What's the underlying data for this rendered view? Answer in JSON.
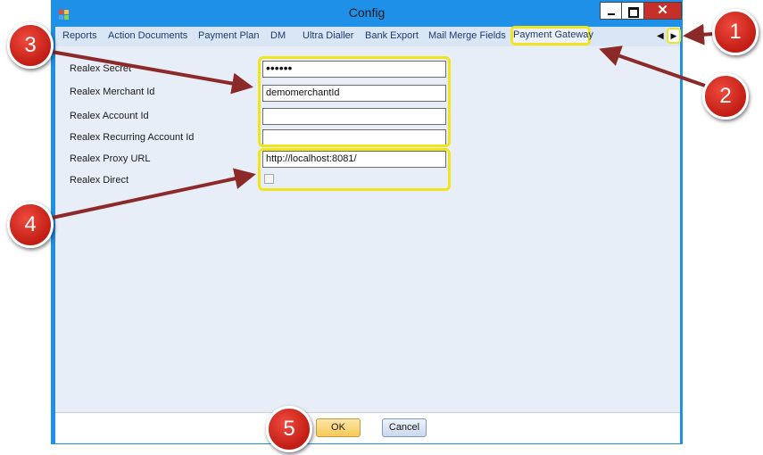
{
  "window": {
    "title": "Config"
  },
  "title_bar_buttons": {
    "close_label": "✕"
  },
  "tabs": {
    "items": [
      "Reports",
      "Action Documents",
      "Payment Plan",
      "DM",
      "Ultra Dialler",
      "Bank Export",
      "Mail Merge Fields"
    ],
    "active": "Payment Gateway",
    "scroll_left": "◀",
    "scroll_right": "▶"
  },
  "form": {
    "fields": [
      {
        "label": "Realex Secret",
        "value": "••••••"
      },
      {
        "label": "Realex Merchant Id",
        "value": "demomerchantId"
      },
      {
        "label": "Realex Account Id",
        "value": ""
      },
      {
        "label": "Realex Recurring Account Id",
        "value": ""
      },
      {
        "label": "Realex Proxy URL",
        "value": "http://localhost:8081/"
      }
    ],
    "direct": {
      "label": "Realex Direct",
      "checked": false
    }
  },
  "footer": {
    "ok_label": "OK",
    "cancel_label": "Cancel"
  },
  "annotations": {
    "markers": [
      "1",
      "2",
      "3",
      "4",
      "5"
    ],
    "marker_color": "#d12a1f",
    "highlight_color": "#f2e41a",
    "arrow_color": "#8c2a2a"
  }
}
